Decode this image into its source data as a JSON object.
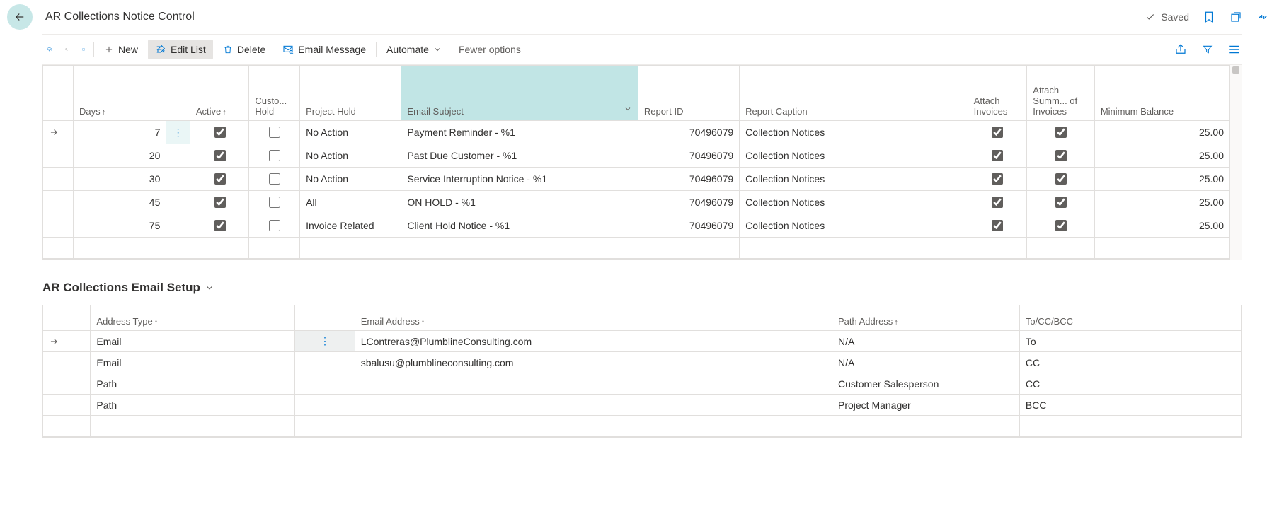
{
  "header": {
    "title": "AR Collections Notice Control",
    "saved_label": "Saved"
  },
  "commands": {
    "new": "New",
    "edit_list": "Edit List",
    "delete": "Delete",
    "email_msg": "Email Message",
    "automate": "Automate",
    "fewer": "Fewer options"
  },
  "main_grid": {
    "cols": {
      "days": "Days",
      "active": "Active",
      "custo_hold": "Custo...\nHold",
      "project_hold": "Project Hold",
      "email_subject": "Email Subject",
      "report_id": "Report ID",
      "report_caption": "Report Caption",
      "attach_inv": "Attach Invoices",
      "attach_summ": "Attach Summ... of Invoices",
      "min_balance": "Minimum Balance"
    },
    "rows": [
      {
        "days": "7",
        "active": true,
        "custo": false,
        "project": "No Action",
        "subject": "Payment Reminder - %1",
        "rid": "70496079",
        "rcap": "Collection Notices",
        "ainv": true,
        "asum": true,
        "min": "25.00"
      },
      {
        "days": "20",
        "active": true,
        "custo": false,
        "project": "No Action",
        "subject": "Past Due Customer - %1",
        "rid": "70496079",
        "rcap": "Collection Notices",
        "ainv": true,
        "asum": true,
        "min": "25.00"
      },
      {
        "days": "30",
        "active": true,
        "custo": false,
        "project": "No Action",
        "subject": "Service Interruption Notice - %1",
        "rid": "70496079",
        "rcap": "Collection Notices",
        "ainv": true,
        "asum": true,
        "min": "25.00"
      },
      {
        "days": "45",
        "active": true,
        "custo": false,
        "project": "All",
        "subject": "ON HOLD - %1",
        "rid": "70496079",
        "rcap": "Collection Notices",
        "ainv": true,
        "asum": true,
        "min": "25.00"
      },
      {
        "days": "75",
        "active": true,
        "custo": false,
        "project": "Invoice Related",
        "subject": "Client Hold Notice - %1",
        "rid": "70496079",
        "rcap": "Collection Notices",
        "ainv": true,
        "asum": true,
        "min": "25.00"
      }
    ]
  },
  "sub_title": "AR Collections Email Setup",
  "email_grid": {
    "cols": {
      "address_type": "Address Type",
      "email": "Email Address",
      "path": "Path Address",
      "to": "To/CC/BCC"
    },
    "rows": [
      {
        "type": "Email",
        "email": "LContreras@PlumblineConsulting.com",
        "path": "N/A",
        "to": "To"
      },
      {
        "type": "Email",
        "email": "sbalusu@plumblineconsulting.com",
        "path": "N/A",
        "to": "CC"
      },
      {
        "type": "Path",
        "email": "",
        "path": "Customer Salesperson",
        "to": "CC"
      },
      {
        "type": "Path",
        "email": "",
        "path": "Project Manager",
        "to": "BCC"
      }
    ]
  }
}
